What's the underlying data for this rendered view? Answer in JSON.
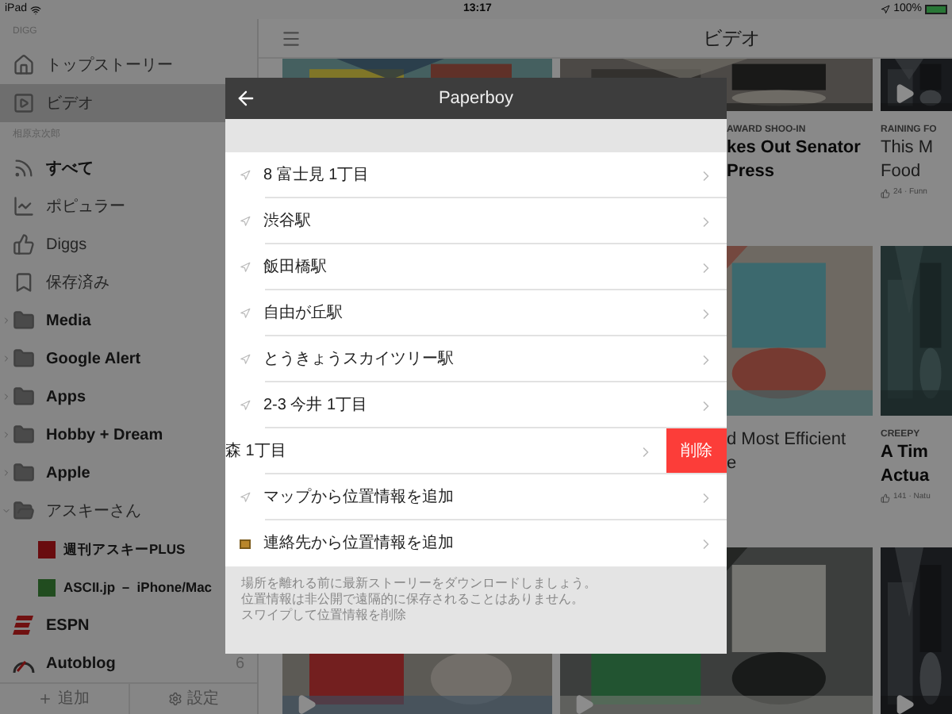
{
  "status_bar": {
    "device": "iPad",
    "time": "13:17",
    "battery": "100%"
  },
  "sidebar": {
    "sections": [
      {
        "title": "DIGG",
        "items": [
          {
            "label": "トップストーリー",
            "kind": "feed",
            "selected": false,
            "unread": false
          },
          {
            "label": "ビデオ",
            "kind": "feed",
            "selected": true,
            "unread": false
          }
        ]
      },
      {
        "title": "相原京次郎",
        "items": [
          {
            "label": "すべて",
            "kind": "feed",
            "selected": false,
            "unread": true
          },
          {
            "label": "ポピュラー",
            "kind": "feed",
            "selected": false,
            "unread": false
          },
          {
            "label": "Diggs",
            "kind": "feed",
            "selected": false,
            "unread": false
          },
          {
            "label": "保存済み",
            "kind": "feed",
            "selected": false,
            "unread": false
          },
          {
            "label": "Media",
            "kind": "folder",
            "selected": false,
            "unread": true,
            "expanded": false
          },
          {
            "label": "Google Alert",
            "kind": "folder",
            "selected": false,
            "unread": true,
            "expanded": false
          },
          {
            "label": "Apps",
            "kind": "folder",
            "selected": false,
            "unread": true,
            "expanded": false
          },
          {
            "label": "Hobby + Dream",
            "kind": "folder",
            "selected": false,
            "unread": true,
            "expanded": false
          },
          {
            "label": "Apple",
            "kind": "folder",
            "selected": false,
            "unread": true,
            "expanded": false
          },
          {
            "label": "アスキーさん",
            "kind": "folder",
            "selected": false,
            "unread": false,
            "expanded": true,
            "children": [
              {
                "label": "週刊アスキーPLUS",
                "kind": "source",
                "selected": false,
                "unread": true
              },
              {
                "label": "ASCII.jp － iPhone/Mac",
                "kind": "source",
                "selected": false,
                "unread": true
              }
            ]
          },
          {
            "label": "ESPN",
            "kind": "source",
            "selected": false,
            "unread": true
          },
          {
            "label": "Autoblog",
            "kind": "source",
            "selected": false,
            "unread": true,
            "count": "6"
          }
        ]
      }
    ],
    "footer": [
      "追加",
      "設定"
    ]
  },
  "main": {
    "title": "ビデオ",
    "cards": [
      {
        "category": "AWARD SHOO-IN",
        "title_lines": [
          "kes Out Senator",
          "Press"
        ],
        "bold": true
      },
      {
        "category": "RAINING FO",
        "title_lines": [
          "This M",
          "Food"
        ],
        "bold": false,
        "meta": "24 · Funn"
      },
      {
        "title_lines": [
          "d Most Efficient",
          "e"
        ],
        "bold": false
      },
      {
        "category": "CREEPY",
        "title_lines": [
          "A Tim",
          "Actua"
        ],
        "bold": true,
        "meta": "141 · Natu"
      }
    ]
  },
  "dialog": {
    "title": "Paperboy",
    "rows": [
      {
        "label": "8 富士見 1丁目",
        "kind": "place",
        "swiped": false
      },
      {
        "label": "渋谷駅",
        "kind": "place",
        "swiped": false
      },
      {
        "label": "飯田橋駅",
        "kind": "place",
        "swiped": false
      },
      {
        "label": "自由が丘駅",
        "kind": "place",
        "swiped": false
      },
      {
        "label": "とうきょうスカイツリー駅",
        "kind": "place",
        "swiped": false
      },
      {
        "label": "2-3 今井 1丁目",
        "kind": "place",
        "swiped": false
      },
      {
        "label": "森 1丁目",
        "kind": "place",
        "swiped": true,
        "delete_label": "削除"
      },
      {
        "label": "マップから位置情報を追加",
        "kind": "map",
        "swiped": false
      },
      {
        "label": "連絡先から位置情報を追加",
        "kind": "contact",
        "swiped": false
      }
    ],
    "note_lines": [
      "場所を離れる前に最新ストーリーをダウンロードしましょう。",
      "位置情報は非公開で遠隔的に保存されることはありません。",
      "スワイプして位置情報を削除"
    ]
  }
}
